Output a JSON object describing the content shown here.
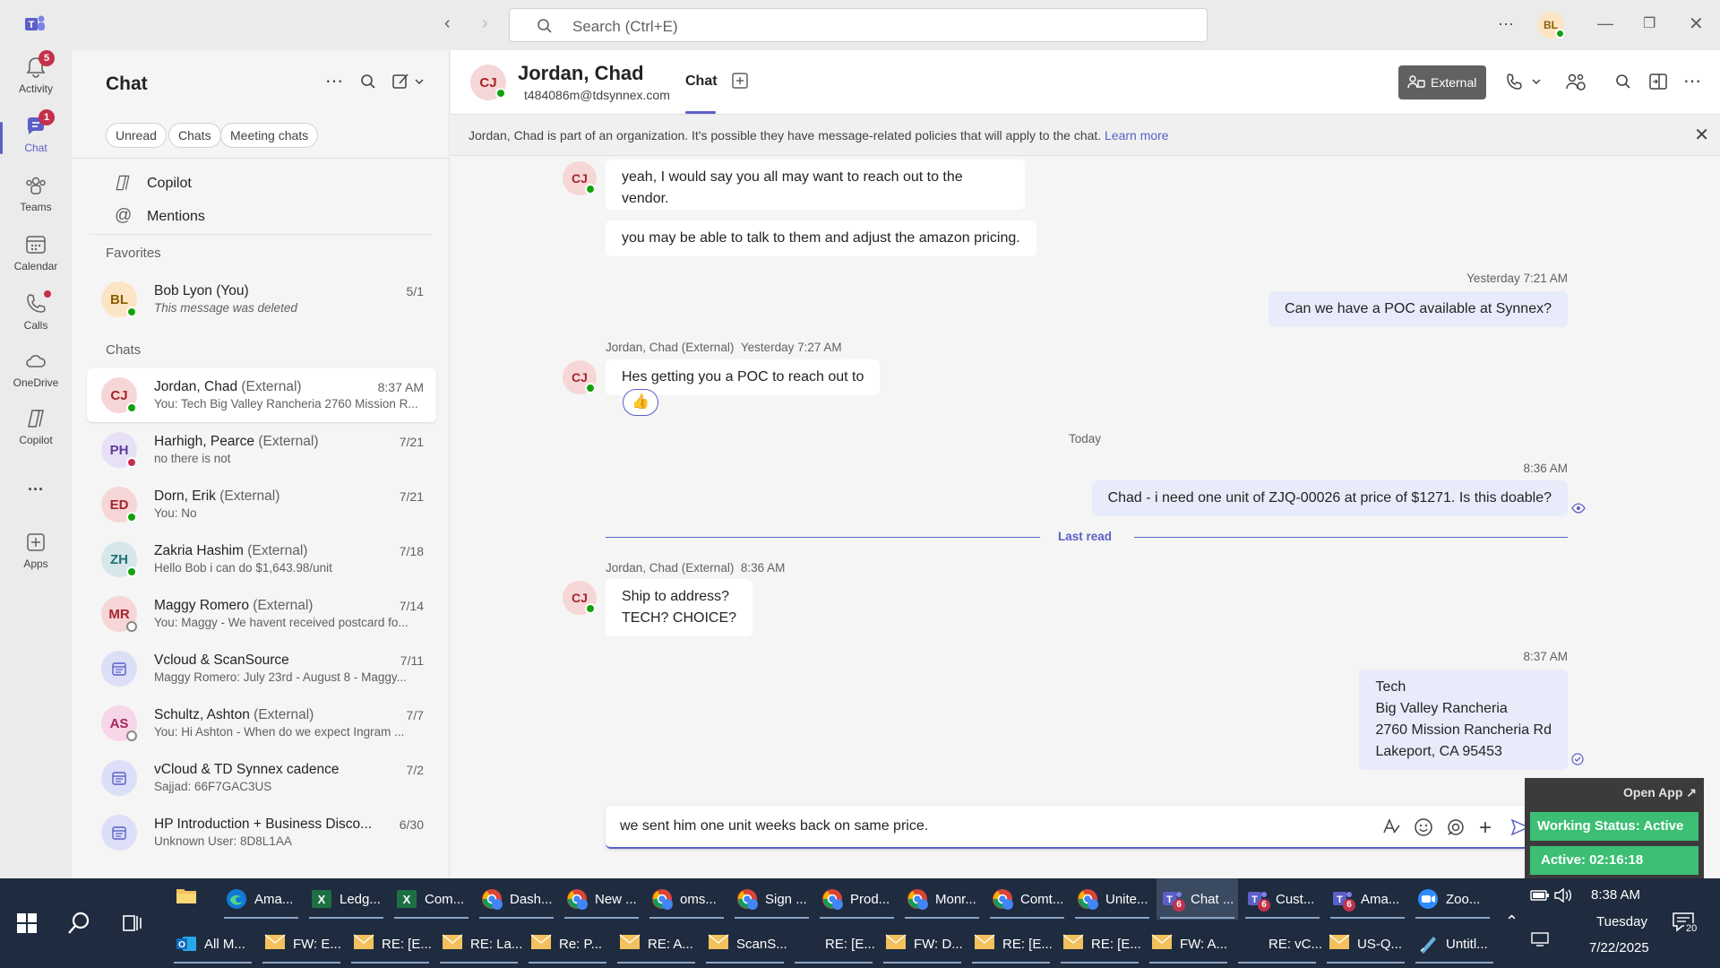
{
  "titlebar": {
    "search_placeholder": "Search (Ctrl+E)",
    "user_initials": "BL",
    "more": "···"
  },
  "rail": [
    {
      "label": "Activity",
      "badge": "5"
    },
    {
      "label": "Chat",
      "badge": "1"
    },
    {
      "label": "Teams",
      "badge": ""
    },
    {
      "label": "Calendar",
      "badge": ""
    },
    {
      "label": "Calls",
      "badge": ""
    },
    {
      "label": "OneDrive",
      "badge": ""
    },
    {
      "label": "Copilot",
      "badge": ""
    },
    {
      "label": "···",
      "badge": ""
    },
    {
      "label": "Apps",
      "badge": ""
    }
  ],
  "chatlist": {
    "title": "Chat",
    "filters": [
      "Unread",
      "Chats",
      "Meeting chats"
    ],
    "copilot": "Copilot",
    "mentions": "Mentions",
    "favorites_label": "Favorites",
    "chats_label": "Chats",
    "favorites": [
      {
        "initials": "BL",
        "name": "Bob Lyon (You)",
        "ext": "",
        "preview": "This message was deleted",
        "time": "5/1",
        "color": "#fce5c4",
        "fg": "#8a5d00",
        "presence": "available"
      }
    ],
    "chats": [
      {
        "initials": "CJ",
        "name": "Jordan, Chad",
        "ext": "(External)",
        "preview": "You: Tech Big Valley Rancheria 2760 Mission R...",
        "time": "8:37 AM",
        "color": "#f6d6d6",
        "fg": "#a4262c",
        "presence": "available"
      },
      {
        "initials": "PH",
        "name": "Harhigh, Pearce",
        "ext": "(External)",
        "preview": "no there is not",
        "time": "7/21",
        "color": "#e8e1f5",
        "fg": "#5c3c9c",
        "presence": "busy"
      },
      {
        "initials": "ED",
        "name": "Dorn, Erik",
        "ext": "(External)",
        "preview": "You: No",
        "time": "7/21",
        "color": "#f6d6d6",
        "fg": "#a4262c",
        "presence": "available"
      },
      {
        "initials": "ZH",
        "name": "Zakria Hashim",
        "ext": "(External)",
        "preview": "Hello Bob i can do $1,643.98/unit",
        "time": "7/18",
        "color": "#d6e7e9",
        "fg": "#1e6f75",
        "presence": "available"
      },
      {
        "initials": "MR",
        "name": "Maggy Romero",
        "ext": "(External)",
        "preview": "You: Maggy - We havent received postcard fo...",
        "time": "7/14",
        "color": "#f6d6d6",
        "fg": "#a4262c",
        "presence": "offline"
      },
      {
        "initials": "",
        "name": "Vcloud & ScanSource",
        "ext": "",
        "preview": "Maggy Romero: July 23rd - August 8 - Maggy...",
        "time": "7/11",
        "color": "#dcdff7",
        "fg": "#5b5fc7",
        "presence": "none"
      },
      {
        "initials": "AS",
        "name": "Schultz, Ashton",
        "ext": "(External)",
        "preview": "You: Hi Ashton -  When do we expect Ingram ...",
        "time": "7/7",
        "color": "#f6d6e7",
        "fg": "#a4265c",
        "presence": "offline"
      },
      {
        "initials": "",
        "name": "vCloud & TD Synnex cadence",
        "ext": "",
        "preview": "Sajjad: 66F7GAC3US",
        "time": "7/2",
        "color": "#dcdff7",
        "fg": "#5b5fc7",
        "presence": "none"
      },
      {
        "initials": "",
        "name": "HP Introduction + Business Disco...",
        "ext": "",
        "preview": "Unknown User: 8D8L1AA",
        "time": "6/30",
        "color": "#dcdff7",
        "fg": "#5b5fc7",
        "presence": "none"
      }
    ]
  },
  "header": {
    "initials": "CJ",
    "name": "Jordan, Chad",
    "email": "t484086m@tdsynnex.com",
    "tab_chat": "Chat",
    "external_label": "External"
  },
  "banner": {
    "text": "Jordan, Chad is part of an organization. It's possible they have message-related policies that will apply to the chat.",
    "link": "Learn more"
  },
  "messages": {
    "m1": "yeah, I would say you all may want to reach out to the vendor.",
    "m2": "you may be able to talk to them and adjust the amazon pricing.",
    "m3_time": "Yesterday 7:21 AM",
    "m3": "Can we have a POC available at Synnex?",
    "m4_meta": "Jordan, Chad (External)",
    "m4_time": "Yesterday 7:27 AM",
    "m4": "Hes getting you a POC to reach out to",
    "m4_reaction": "👍",
    "divider_today": "Today",
    "m5_time": "8:36 AM",
    "m5": "Chad -  i need one unit of ZJQ-00026  at price of $1271. Is this doable?",
    "last_read": "Last read",
    "m6_meta": "Jordan, Chad (External)",
    "m6_time": "8:36 AM",
    "m6_line1": "Ship to address?",
    "m6_line2": "TECH? CHOICE?",
    "m7_time": "8:37 AM",
    "m7_lines": [
      "Tech",
      "Big Valley Rancheria",
      "2760 Mission Rancheria Rd",
      "Lakeport, CA 95453"
    ]
  },
  "composer": {
    "text": "we sent him one unit  weeks back on same price."
  },
  "widget": {
    "open_app": "Open App ↗",
    "status": "Working Status: Active",
    "active": "Active: 02:16:18"
  },
  "taskbar": {
    "row1": [
      {
        "label": "Ama...",
        "icon": "edge",
        "color": "#0f7bd6"
      },
      {
        "label": "Ledg...",
        "icon": "excel",
        "color": "#1d7044"
      },
      {
        "label": "Com...",
        "icon": "excel",
        "color": "#1d7044"
      },
      {
        "label": "Dash...",
        "icon": "chrome",
        "color": "#db4437"
      },
      {
        "label": "New ...",
        "icon": "chrome",
        "color": "#db4437"
      },
      {
        "label": "oms...",
        "icon": "chrome",
        "color": "#db4437"
      },
      {
        "label": "Sign ...",
        "icon": "chrome",
        "color": "#db4437"
      },
      {
        "label": "Prod...",
        "icon": "chrome",
        "color": "#db4437"
      },
      {
        "label": "Monr...",
        "icon": "chrome",
        "color": "#db4437"
      },
      {
        "label": "Comt...",
        "icon": "chrome",
        "color": "#db4437"
      },
      {
        "label": "Unite...",
        "icon": "chrome",
        "color": "#db4437"
      },
      {
        "label": "Chat ...",
        "icon": "teams",
        "color": "#5b5fc7"
      },
      {
        "label": "Cust...",
        "icon": "teams",
        "color": "#5b5fc7"
      },
      {
        "label": "Ama...",
        "icon": "teams",
        "color": "#5b5fc7"
      },
      {
        "label": "Zoo...",
        "icon": "zoom",
        "color": "#2d8cff"
      }
    ],
    "row2": [
      {
        "label": "All M...",
        "icon": "outlook",
        "color": "#0f6cbd"
      },
      {
        "label": "FW: E...",
        "icon": "mail",
        "color": "#f2c05c"
      },
      {
        "label": "RE: [E...",
        "icon": "mail",
        "color": "#f2c05c"
      },
      {
        "label": "RE: La...",
        "icon": "mail",
        "color": "#f2c05c"
      },
      {
        "label": "Re: P...",
        "icon": "mail",
        "color": "#f2c05c"
      },
      {
        "label": "RE: A...",
        "icon": "mail",
        "color": "#f2c05c"
      },
      {
        "label": "ScanS...",
        "icon": "mail",
        "color": "#f2c05c"
      },
      {
        "label": "RE: [E...",
        "icon": "none",
        "color": ""
      },
      {
        "label": "FW: D...",
        "icon": "mail",
        "color": "#f2c05c"
      },
      {
        "label": "RE: [E...",
        "icon": "mail",
        "color": "#f2c05c"
      },
      {
        "label": "RE: [E...",
        "icon": "mail",
        "color": "#f2c05c"
      },
      {
        "label": "FW: A...",
        "icon": "mail",
        "color": "#f2c05c"
      },
      {
        "label": "RE: vC...",
        "icon": "none",
        "color": ""
      },
      {
        "label": "US-Q...",
        "icon": "mail",
        "color": "#f2c05c"
      },
      {
        "label": "Untitl...",
        "icon": "paint",
        "color": "#6ab0de"
      }
    ],
    "teams_badge": "6",
    "time": "8:38 AM",
    "day": "Tuesday",
    "date": "7/22/2025",
    "notif_count": "20"
  }
}
